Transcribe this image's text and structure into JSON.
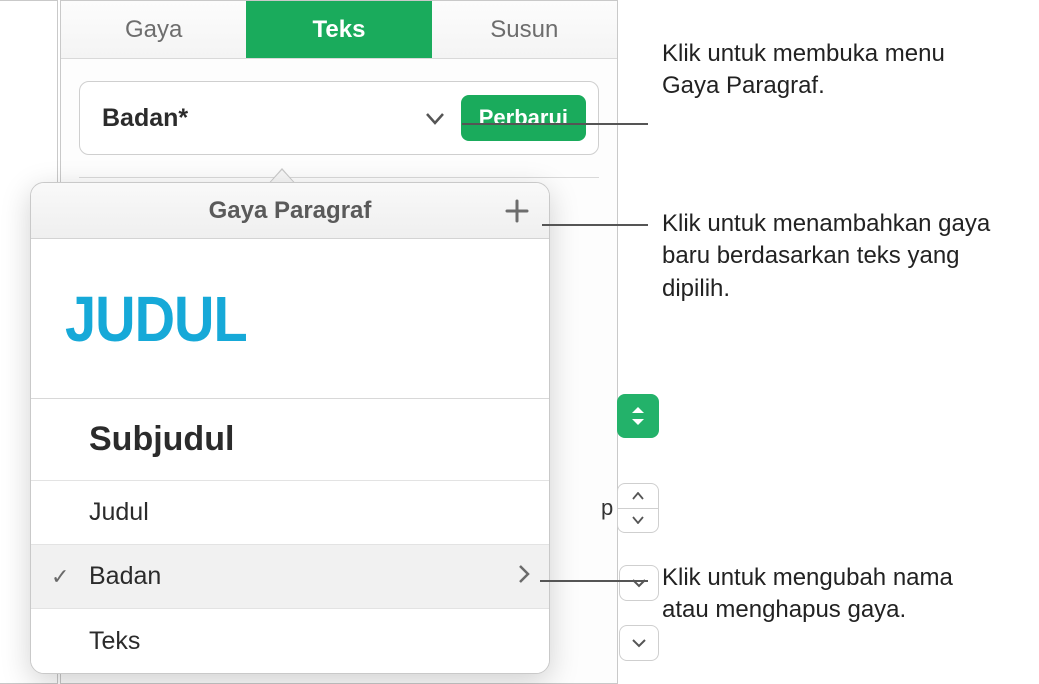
{
  "tabs": {
    "style": "Gaya",
    "text": "Teks",
    "arrange": "Susun"
  },
  "styleBox": {
    "current": "Badan*",
    "updateLabel": "Perbarui"
  },
  "popover": {
    "title": "Gaya Paragraf",
    "previewTitle": "JUDUL",
    "rows": {
      "subtitle": "Subjudul",
      "heading": "Judul",
      "body": "Badan",
      "text": "Teks"
    }
  },
  "peek": {
    "letter": "p"
  },
  "callouts": {
    "c1": "Klik untuk membuka menu Gaya Paragraf.",
    "c2": "Klik untuk menambahkan gaya baru berdasarkan teks yang dipilih.",
    "c3": "Klik untuk mengubah nama atau menghapus gaya."
  }
}
